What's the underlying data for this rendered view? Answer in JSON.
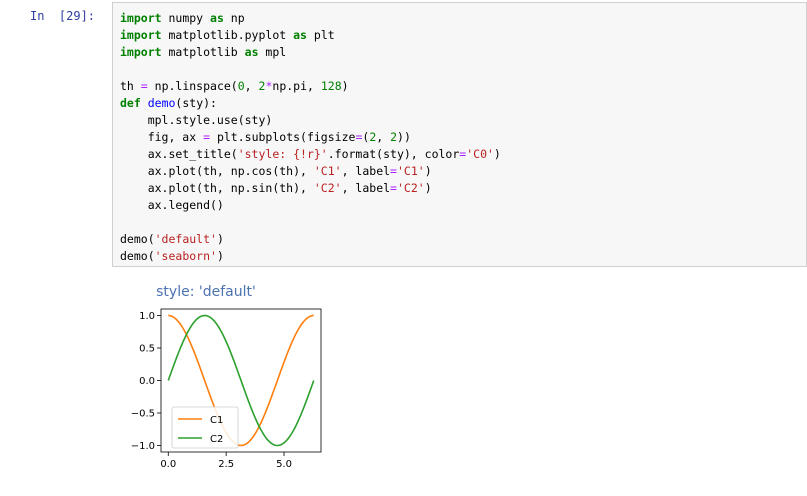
{
  "cell": {
    "prompt": "In  [29]:",
    "code_lines": [
      [
        {
          "t": "kw",
          "v": "import"
        },
        {
          "t": "",
          "v": " numpy "
        },
        {
          "t": "kw",
          "v": "as"
        },
        {
          "t": "",
          "v": " np"
        }
      ],
      [
        {
          "t": "kw",
          "v": "import"
        },
        {
          "t": "",
          "v": " matplotlib.pyplot "
        },
        {
          "t": "kw",
          "v": "as"
        },
        {
          "t": "",
          "v": " plt"
        }
      ],
      [
        {
          "t": "kw",
          "v": "import"
        },
        {
          "t": "",
          "v": " matplotlib "
        },
        {
          "t": "kw",
          "v": "as"
        },
        {
          "t": "",
          "v": " mpl"
        }
      ],
      [],
      [
        {
          "t": "",
          "v": "th "
        },
        {
          "t": "op",
          "v": "="
        },
        {
          "t": "",
          "v": " np.linspace("
        },
        {
          "t": "num",
          "v": "0"
        },
        {
          "t": "",
          "v": ", "
        },
        {
          "t": "num",
          "v": "2"
        },
        {
          "t": "op",
          "v": "*"
        },
        {
          "t": "",
          "v": "np.pi, "
        },
        {
          "t": "num",
          "v": "128"
        },
        {
          "t": "",
          "v": ")"
        }
      ],
      [
        {
          "t": "kw",
          "v": "def"
        },
        {
          "t": "",
          "v": " "
        },
        {
          "t": "fn",
          "v": "demo"
        },
        {
          "t": "",
          "v": "(sty):"
        }
      ],
      [
        {
          "t": "",
          "v": "    mpl.style.use(sty)"
        }
      ],
      [
        {
          "t": "",
          "v": "    fig, ax "
        },
        {
          "t": "op",
          "v": "="
        },
        {
          "t": "",
          "v": " plt.subplots(figsize"
        },
        {
          "t": "op",
          "v": "="
        },
        {
          "t": "",
          "v": "("
        },
        {
          "t": "num",
          "v": "2"
        },
        {
          "t": "",
          "v": ", "
        },
        {
          "t": "num",
          "v": "2"
        },
        {
          "t": "",
          "v": "))"
        }
      ],
      [
        {
          "t": "",
          "v": "    ax.set_title("
        },
        {
          "t": "str",
          "v": "'style: {!r}'"
        },
        {
          "t": "",
          "v": ".format(sty), color"
        },
        {
          "t": "op",
          "v": "="
        },
        {
          "t": "str",
          "v": "'C0'"
        },
        {
          "t": "",
          "v": ")"
        }
      ],
      [
        {
          "t": "",
          "v": "    ax.plot(th, np.cos(th), "
        },
        {
          "t": "str",
          "v": "'C1'"
        },
        {
          "t": "",
          "v": ", label"
        },
        {
          "t": "op",
          "v": "="
        },
        {
          "t": "str",
          "v": "'C1'"
        },
        {
          "t": "",
          "v": ")"
        }
      ],
      [
        {
          "t": "",
          "v": "    ax.plot(th, np.sin(th), "
        },
        {
          "t": "str",
          "v": "'C2'"
        },
        {
          "t": "",
          "v": ", label"
        },
        {
          "t": "op",
          "v": "="
        },
        {
          "t": "str",
          "v": "'C2'"
        },
        {
          "t": "",
          "v": ")"
        }
      ],
      [
        {
          "t": "",
          "v": "    ax.legend()"
        }
      ],
      [],
      [
        {
          "t": "",
          "v": "demo("
        },
        {
          "t": "str",
          "v": "'default'"
        },
        {
          "t": "",
          "v": ")"
        }
      ],
      [
        {
          "t": "",
          "v": "demo("
        },
        {
          "t": "str",
          "v": "'seaborn'"
        },
        {
          "t": "",
          "v": ")"
        }
      ]
    ]
  },
  "chart_data": {
    "type": "line",
    "title": "style: 'default'",
    "title_color": "#4c72b0",
    "xlim": [
      -0.314,
      6.597
    ],
    "ylim": [
      -1.1,
      1.1
    ],
    "x_ticks": [
      0.0,
      2.5,
      5.0
    ],
    "x_tick_labels": [
      "0.0",
      "2.5",
      "5.0"
    ],
    "y_ticks": [
      1.0,
      0.5,
      0.0,
      -0.5,
      -1.0
    ],
    "y_tick_labels": [
      "1.0",
      "0.5",
      "0.0",
      "−0.5",
      "−1.0"
    ],
    "x_domain": [
      0,
      6.2832
    ],
    "num_points": 128,
    "series": [
      {
        "name": "C1",
        "function": "cos",
        "color": "#ff7f0e"
      },
      {
        "name": "C2",
        "function": "sin",
        "color": "#2ca02c"
      }
    ],
    "legend": {
      "location": "lower-left"
    }
  }
}
